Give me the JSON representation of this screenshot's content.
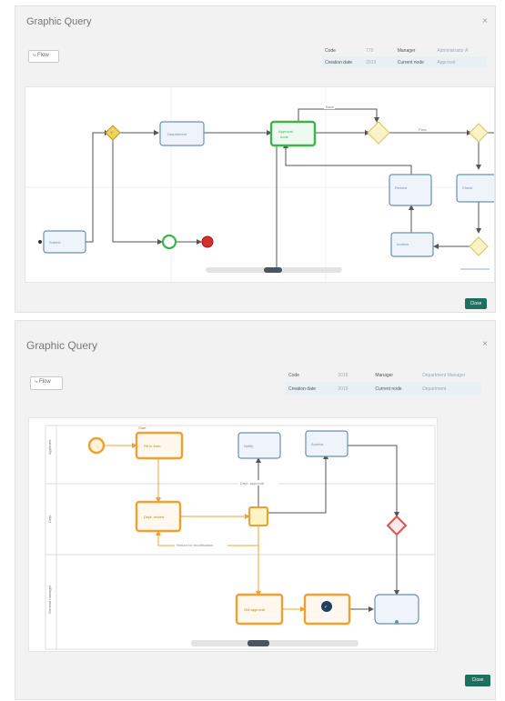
{
  "dialog_top": {
    "title": "Graphic Query",
    "close_icon": "close-icon",
    "flow_button_label": "Flow",
    "info": {
      "row1": {
        "k1": "Code",
        "v1": "779",
        "k2": "Manager",
        "v2": "Administrator A"
      },
      "row2": {
        "k1": "Creation date",
        "v1": "2019",
        "k2": "Current node",
        "v2": "Approval"
      }
    },
    "ok_button_label": "Close",
    "colors": {
      "node_stroke": "#6b8fb8",
      "node_fill": "#eef4fa",
      "active": "#3bb54a",
      "end": "#d32f2f",
      "gateway": "#f3d25c"
    }
  },
  "dialog_bottom": {
    "title": "Graphic Query",
    "close_icon": "close-icon",
    "flow_button_label": "Flow",
    "info": {
      "row1": {
        "k1": "Code",
        "v1": "2018",
        "k2": "Manager",
        "v2": "Department Manager"
      },
      "row2": {
        "k1": "Creation date",
        "v1": "2019",
        "k2": "Current node",
        "v2": "Department"
      }
    },
    "ok_button_label": "Close",
    "colors": {
      "done": "#f0a030",
      "pending": "#6b8fb8",
      "gateway_red": "#d9534f"
    }
  }
}
